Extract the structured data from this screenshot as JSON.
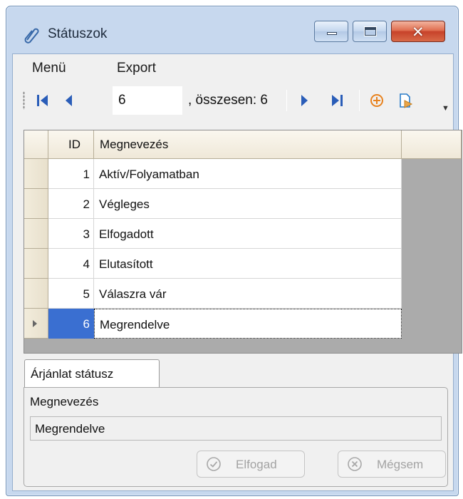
{
  "window": {
    "title": "Státuszok"
  },
  "menu": {
    "items": [
      "Menü",
      "Export"
    ]
  },
  "navigator": {
    "position": "6",
    "count_label": ", összesen: 6"
  },
  "grid": {
    "columns": [
      "ID",
      "Megnevezés"
    ],
    "rows": [
      {
        "id": "1",
        "name": "Aktív/Folyamatban"
      },
      {
        "id": "2",
        "name": "Végleges"
      },
      {
        "id": "3",
        "name": "Elfogadott"
      },
      {
        "id": "4",
        "name": "Elutasított"
      },
      {
        "id": "5",
        "name": "Válaszra vár"
      },
      {
        "id": "6",
        "name": "Megrendelve"
      }
    ],
    "selected_row_index": 5
  },
  "detail": {
    "tab_label": "Árjánlat státusz",
    "field_label": "Megnevezés",
    "field_value": "Megrendelve"
  },
  "actions": {
    "accept_label": "Elfogad",
    "cancel_label": "Mégsem"
  },
  "colors": {
    "selection": "#3a6fd1",
    "accent_orange": "#e8821e",
    "nav_blue": "#2a5db8"
  }
}
